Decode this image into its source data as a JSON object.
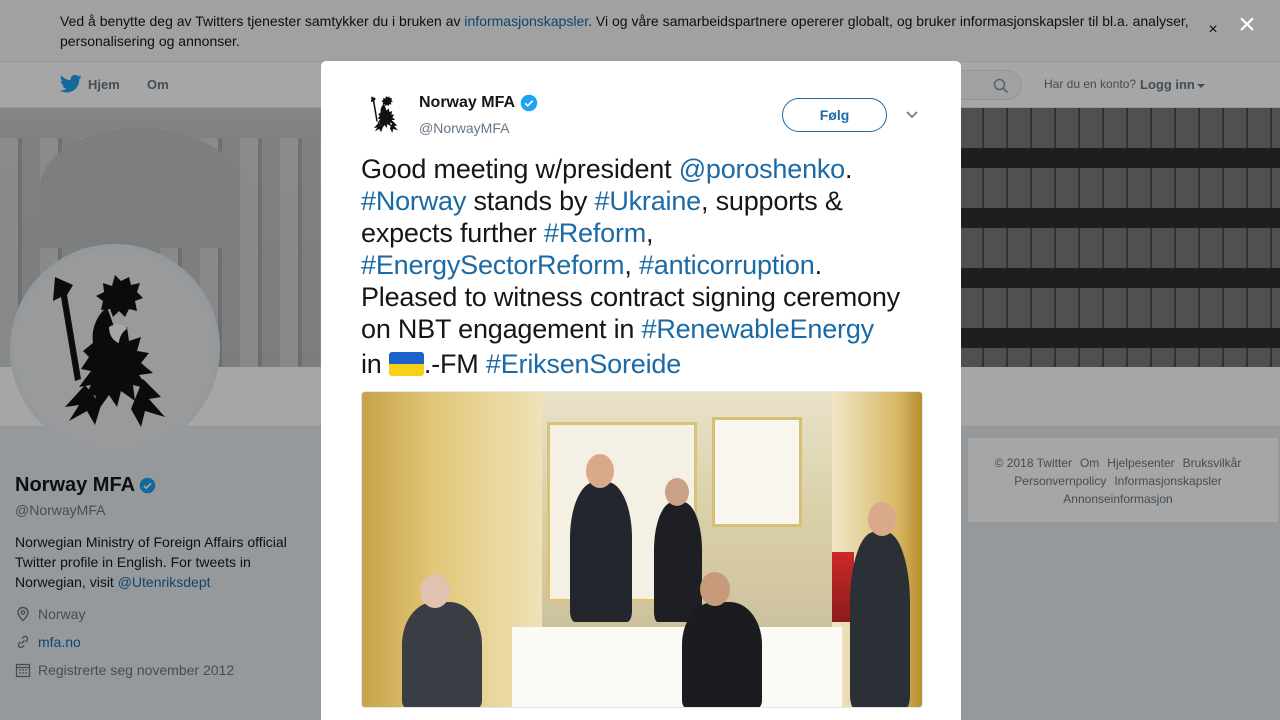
{
  "cookie_banner": {
    "text_before": "Ved å benytte deg av Twitters tjenester samtykker du i bruken av ",
    "link": "informasjonskapsler",
    "text_after": ". Vi og våre samarbeidspartnere opererer globalt, og bruker informasjonskapsler til bl.a. analyser, personalisering og annonser.",
    "close": "×"
  },
  "nav": {
    "home": "Hjem",
    "about": "Om",
    "account_prompt": "Har du en konto?",
    "login": "Logg inn"
  },
  "profile": {
    "name": "Norway MFA",
    "handle": "@NorwayMFA",
    "bio": "Norwegian Ministry of Foreign Affairs official Twitter profile in English. For tweets in Norwegian, visit ",
    "bio_link": "@Utenriksdept",
    "location": "Norway",
    "website": "mfa.no",
    "joined": "Registrerte seg november 2012"
  },
  "footer": {
    "links": [
      "© 2018 Twitter",
      "Om",
      "Hjelpesenter",
      "Bruksvilkår",
      "Personvernpolicy",
      "Informasjonskapsler",
      "Annonseinformasjon"
    ]
  },
  "modal": {
    "close": "×",
    "author_name": "Norway MFA",
    "author_handle": "@NorwayMFA",
    "follow": "Følg",
    "tweet": {
      "l1_a": "Good meeting w/president ",
      "l1_mention": "@poroshenko",
      "l1_b": ".",
      "l2_tag1": "#Norway",
      "l2_a": " stands by ",
      "l2_tag2": "#Ukraine",
      "l2_b": ", supports &",
      "l3_a": "expects further ",
      "l3_tag": "#Reform",
      "l3_b": ",",
      "l4_tag1": "#EnergySectorReform",
      "l4_a": ", ",
      "l4_tag2": "#anticorruption",
      "l4_b": ".",
      "l5": "Pleased to witness contract signing ceremony",
      "l6_a": "on NBT engagement in ",
      "l6_tag": "#RenewableEnergy",
      "l7_a": "in ",
      "l7_b": ".-FM ",
      "l7_tag": "#EriksenSoreide"
    }
  },
  "colors": {
    "link": "#1b6aa5",
    "verified": "#1da1f2",
    "ukraine_blue": "#1c64c9",
    "ukraine_yellow": "#f8d019"
  }
}
